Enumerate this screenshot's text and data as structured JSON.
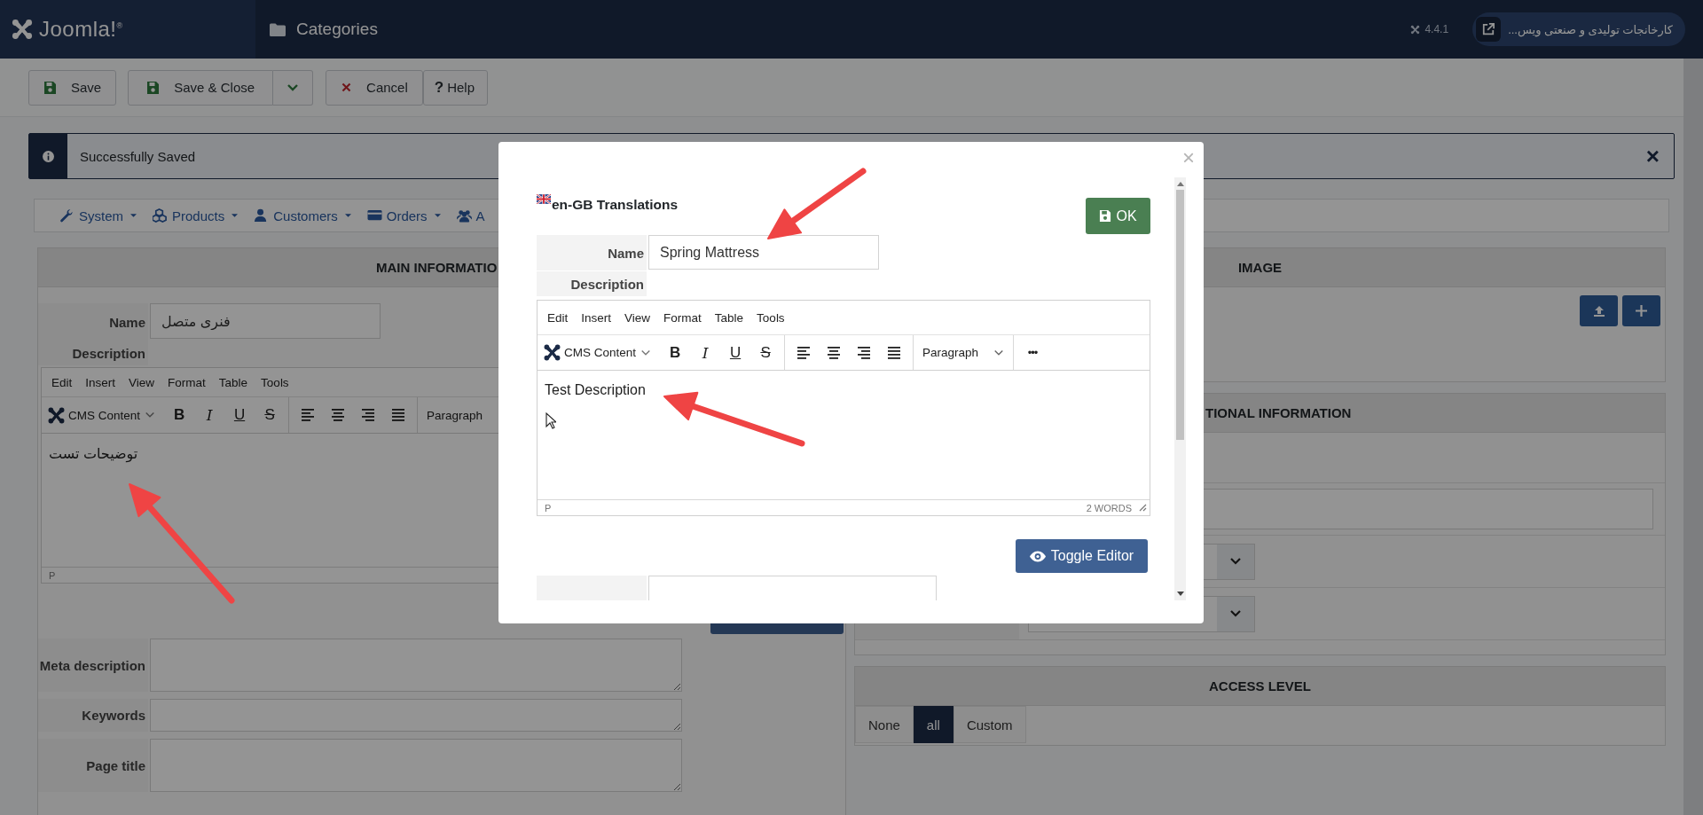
{
  "header": {
    "logo": "Joomla!",
    "logo_mark": "®",
    "title": "Categories",
    "version": "4.4.1",
    "site_link": "کارخانجات تولیدی و صنعتی ویس..."
  },
  "toolbar": [
    {
      "label": "Save",
      "kind": "save"
    },
    {
      "label": "Save & Close",
      "kind": "save-split"
    },
    {
      "label": "Cancel",
      "kind": "cancel"
    },
    {
      "label": "Help",
      "kind": "help",
      "icon": "?"
    }
  ],
  "alert": {
    "message": "Successfully Saved",
    "close": "×"
  },
  "nav": [
    {
      "label": "System",
      "kind": "wrench"
    },
    {
      "label": "Products",
      "kind": "cubes"
    },
    {
      "label": "Customers",
      "kind": "user"
    },
    {
      "label": "Orders",
      "kind": "card"
    },
    {
      "label": "A",
      "kind": "users"
    }
  ],
  "main_panel": {
    "heading": "MAIN INFORMATIO",
    "name_label": "Name",
    "name_value": "فنری متصل",
    "description_label": "Description",
    "editor": {
      "menu": [
        "Edit",
        "Insert",
        "View",
        "Format",
        "Table",
        "Tools"
      ],
      "cms": "CMS Content",
      "format_buttons": [
        {
          "label": "B",
          "kind": "bold"
        },
        {
          "label": "I",
          "kind": "italic"
        },
        {
          "label": "U",
          "kind": "underline"
        },
        {
          "label": "S",
          "kind": "strike"
        }
      ],
      "block_format": "Paragraph",
      "content": "توضیحات تست",
      "path": "P"
    },
    "fields": [
      {
        "label": "Meta description",
        "kind": "tall"
      },
      {
        "label": "Keywords",
        "kind": "short"
      },
      {
        "label": "Page title",
        "kind": "tall"
      }
    ]
  },
  "image_panel": {
    "heading": "IMAGE"
  },
  "additional_panel": {
    "heading": "TIONAL INFORMATION"
  },
  "access_panel": {
    "heading": "ACCESS LEVEL",
    "options": [
      {
        "label": "None",
        "selected": false
      },
      {
        "label": "all",
        "selected": true
      },
      {
        "label": "Custom",
        "selected": false
      }
    ]
  },
  "modal": {
    "close": "×",
    "title": "en-GB Translations",
    "ok": "OK",
    "name_label": "Name",
    "name_value": "Spring Mattress",
    "description_label": "Description",
    "editor": {
      "menu": [
        "Edit",
        "Insert",
        "View",
        "Format",
        "Table",
        "Tools"
      ],
      "cms": "CMS Content",
      "format_buttons": [
        {
          "label": "B",
          "kind": "bold"
        },
        {
          "label": "I",
          "kind": "italic"
        },
        {
          "label": "U",
          "kind": "underline"
        },
        {
          "label": "S",
          "kind": "strike"
        }
      ],
      "block_format": "Paragraph",
      "more": "•••",
      "content": "Test Description",
      "path": "P",
      "word_count": "2 WORDS"
    },
    "toggle": "Toggle Editor"
  }
}
